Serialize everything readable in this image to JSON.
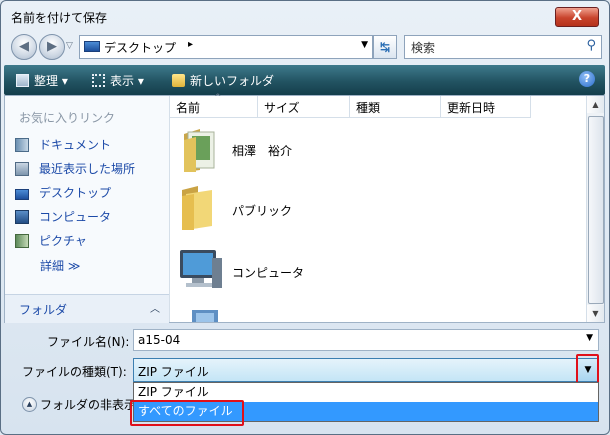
{
  "window": {
    "title": "名前を付けて保存",
    "close_label": "X"
  },
  "nav": {
    "back_glyph": "◀",
    "forward_glyph": "▶"
  },
  "address": {
    "location": "デスクトップ",
    "separator": "▸"
  },
  "search": {
    "placeholder": "検索"
  },
  "toolbar": {
    "organize": "整理 ▾",
    "views": "表示 ▾",
    "new_folder": "新しいフォルダ",
    "help": "?"
  },
  "favorites": {
    "header": "お気に入りリンク",
    "items": [
      {
        "label": "ドキュメント",
        "icon": "documents-icon"
      },
      {
        "label": "最近表示した場所",
        "icon": "recent-places-icon"
      },
      {
        "label": "デスクトップ",
        "icon": "desktop-icon"
      },
      {
        "label": "コンピュータ",
        "icon": "computer-icon"
      },
      {
        "label": "ピクチャ",
        "icon": "pictures-icon"
      }
    ],
    "more": "詳細 ≫"
  },
  "folders_bar": {
    "label": "フォルダ",
    "chevron": "︿"
  },
  "columns": [
    "名前",
    "サイズ",
    "種類",
    "更新日時"
  ],
  "files": [
    {
      "name": "相澤　裕介",
      "icon": "user-folder-icon"
    },
    {
      "name": "パブリック",
      "icon": "folder-icon"
    },
    {
      "name": "コンピュータ",
      "icon": "computer-icon"
    }
  ],
  "form": {
    "filename_label": "ファイル名(N):",
    "filename_value": "a15-04",
    "filetype_label": "ファイルの種類(T):",
    "filetype_value": "ZIP ファイル",
    "filetype_options": [
      "ZIP ファイル",
      "すべてのファイル"
    ],
    "hide_folders": "フォルダの非表示"
  },
  "colors": {
    "highlight": "#3399ff",
    "annotation": "#e0101a",
    "toolbar": "#225362"
  }
}
